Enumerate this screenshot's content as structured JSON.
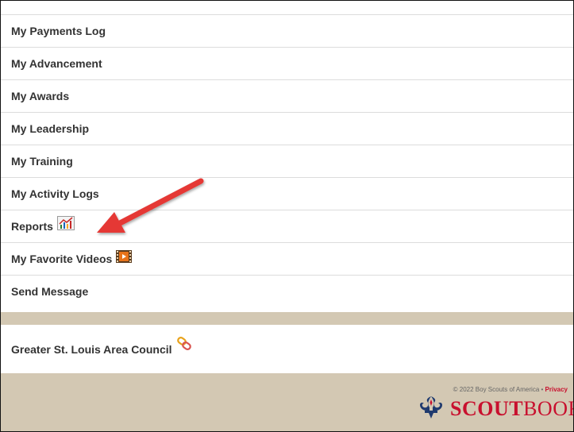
{
  "menu": {
    "items": [
      {
        "label": "My Payments Log"
      },
      {
        "label": "My Advancement"
      },
      {
        "label": "My Awards"
      },
      {
        "label": "My Leadership"
      },
      {
        "label": "My Training"
      },
      {
        "label": "My Activity Logs"
      },
      {
        "label": "Reports",
        "icon": "chart-icon"
      },
      {
        "label": "My Favorite Videos",
        "icon": "video-icon"
      },
      {
        "label": "Send Message"
      }
    ]
  },
  "council": {
    "label": "Greater St. Louis Area Council",
    "icon": "link-icon"
  },
  "footer": {
    "copyright": "© 2022 Boy Scouts of America",
    "separator": " • ",
    "privacy_label": "Privacy",
    "brand_bold": "SCOUT",
    "brand_rest": "BOOK"
  },
  "colors": {
    "brand_red": "#c8102e",
    "footer_bg": "#d3c8b3",
    "annotation_arrow": "#e53935"
  }
}
